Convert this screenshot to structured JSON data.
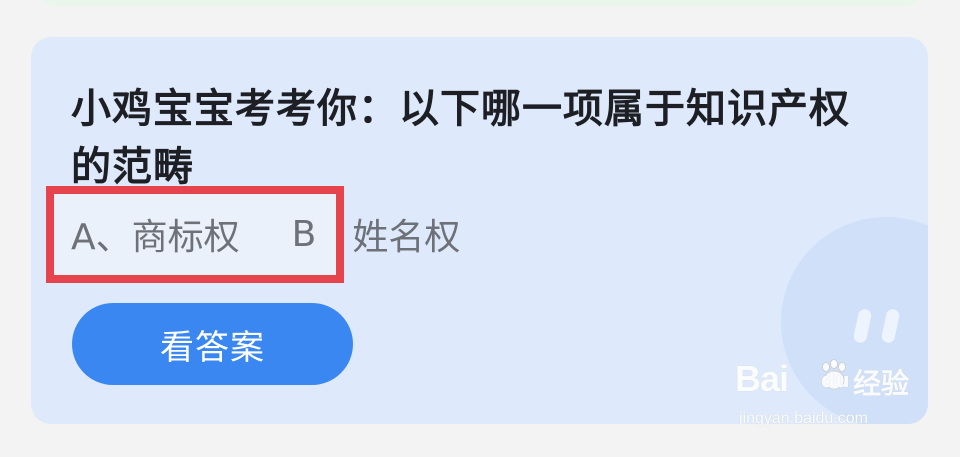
{
  "card": {
    "question": "小鸡宝宝考考你：以下哪一项属于知识产权的范畴",
    "option_a": "A、商标权",
    "option_b_letter": "B",
    "option_b_text": "姓名权",
    "answer_button_label": "看答案"
  },
  "watermark": {
    "logo": "Bai",
    "logo_suffix": "du",
    "product": "经验",
    "url": "jingyan.baidu.com"
  },
  "colors": {
    "card_background": "#deeafb",
    "button": "#3b87f1",
    "highlight": "#e5444d"
  },
  "icons": [
    "mascot-icon",
    "paw-icon"
  ]
}
